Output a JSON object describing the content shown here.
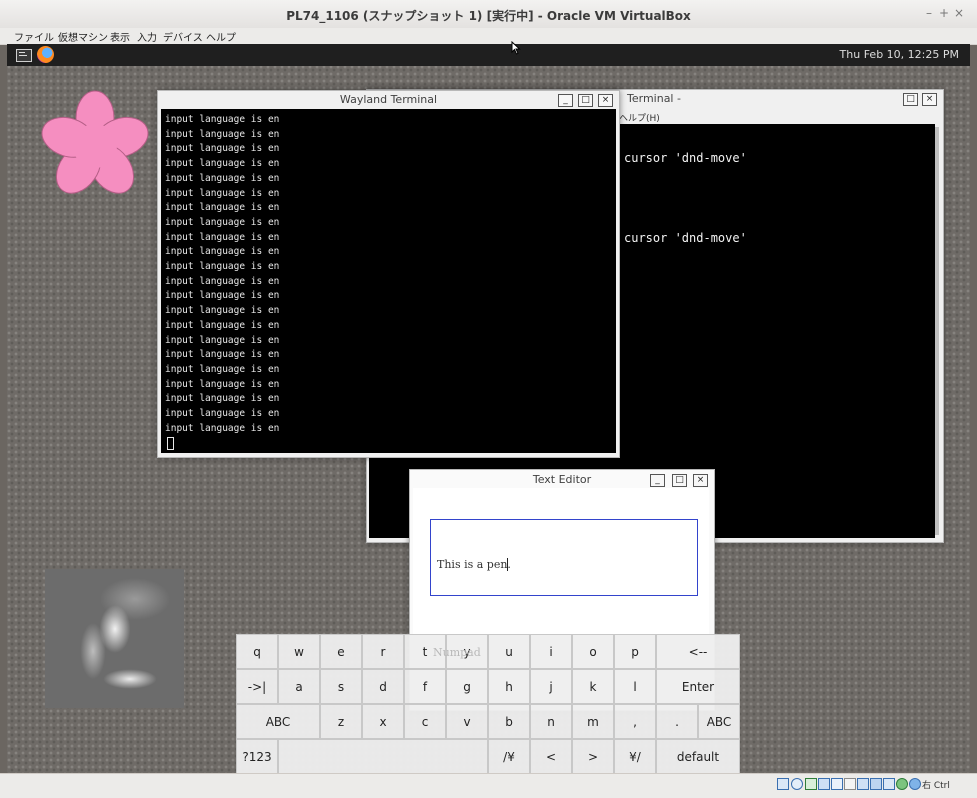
{
  "host": {
    "title": "PL74_1106 (スナップショット 1) [実行中] - Oracle VM VirtualBox",
    "window_buttons": [
      "–",
      "+",
      "×"
    ],
    "menu": [
      "ファイル",
      "仮想マシン",
      "表示",
      "入力",
      "デバイス",
      "ヘルプ"
    ],
    "status_host_key": "右 Ctrl"
  },
  "panel": {
    "clock": "Thu Feb 10, 12:25 PM"
  },
  "wayland_terminal": {
    "title": "Wayland Terminal",
    "buttons": [
      "_",
      "□",
      "×"
    ],
    "lines": [
      "input language is en",
      "input language is en",
      "input language is en",
      "input language is en",
      "input language is en",
      "input language is en",
      "input language is en",
      "input language is en",
      "input language is en",
      "input language is en",
      "input language is en",
      "input language is en",
      "input language is en",
      "input language is en",
      "input language is en",
      "input language is en",
      "input language is en",
      "input language is en",
      "input language is en",
      "input language is en",
      "input language is en",
      "input language is en"
    ]
  },
  "back_terminal": {
    "title": "Terminal -",
    "menu_fragment": "ヘルプ(H)",
    "buttons": [
      "□",
      "×"
    ],
    "lines": [
      "cursor 'dnd-move'",
      "cursor 'dnd-move'"
    ]
  },
  "text_editor": {
    "title": "Text Editor",
    "buttons": [
      "_",
      "□",
      "×"
    ],
    "content": "This is a pen."
  },
  "keyboard": {
    "overlay_label": "Numpad",
    "rows": [
      [
        "q",
        "w",
        "e",
        "r",
        "t",
        "y",
        "u",
        "i",
        "o",
        "p",
        "<--"
      ],
      [
        "->|",
        "a",
        "s",
        "d",
        "f",
        "g",
        "h",
        "j",
        "k",
        "l",
        "Enter"
      ],
      [
        "ABC",
        "z",
        "x",
        "c",
        "v",
        "b",
        "n",
        "m",
        ",",
        ".",
        "ABC"
      ],
      [
        "?123",
        "",
        "/¥",
        "<",
        ">",
        "¥/",
        "default"
      ]
    ]
  },
  "colors": {
    "flower": "#f58ec0",
    "editor_border": "#3344cc",
    "panel": "#1f1f1f"
  }
}
